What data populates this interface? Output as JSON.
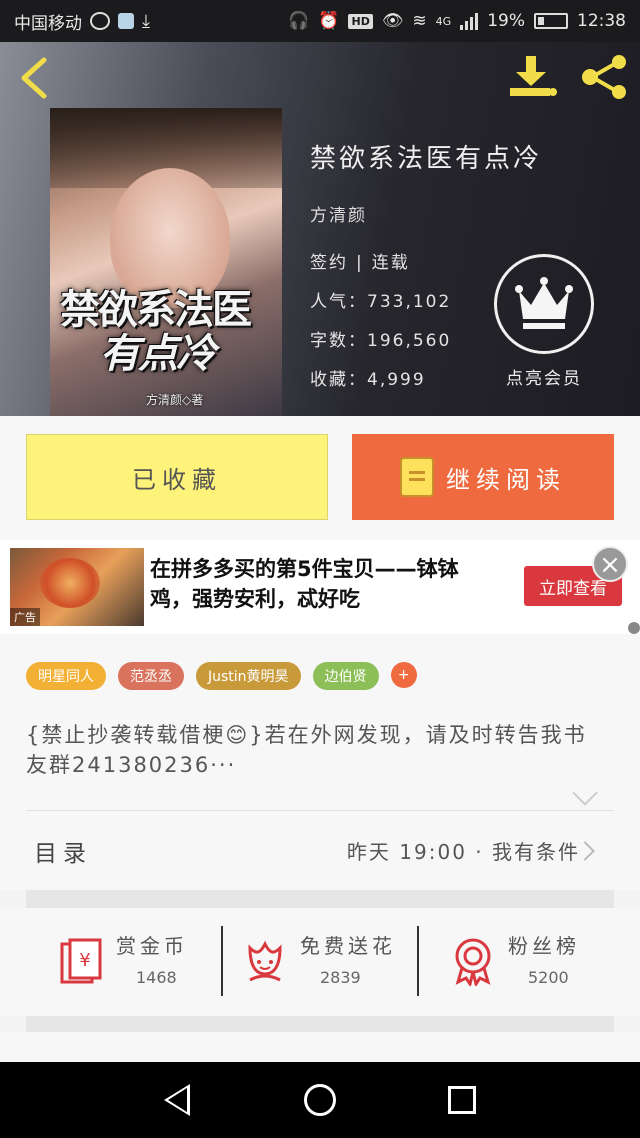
{
  "status_bar": {
    "carrier": "中国移动",
    "network": "4G",
    "battery": "19%",
    "time": "12:38",
    "hd": "HD"
  },
  "header": {
    "back_icon": "chevron-left-icon",
    "download_icon": "download-icon",
    "share_icon": "share-icon"
  },
  "book": {
    "cover_title_line1": "禁欲系法医",
    "cover_title_line2": "有点冷",
    "cover_author": "方清颜◇著",
    "title": "禁欲系法医有点冷",
    "author": "方清颜",
    "status_signed": "签约",
    "status_serial": "连载",
    "popularity_label": "人气：",
    "popularity": "733,102",
    "word_count_label": "字数：",
    "word_count": "196,560",
    "favorites_label": "收藏：",
    "favorites": "4,999"
  },
  "vip": {
    "label": "点亮会员",
    "icon": "crown-icon"
  },
  "actions": {
    "collected_label": "已收藏",
    "continue_label": "继续阅读",
    "continue_icon": "book-icon"
  },
  "ad": {
    "tag": "广告",
    "text": "在拼多多买的第5件宝贝——钵钵鸡，强势安利，忒好吃",
    "cta": "立即查看"
  },
  "tags": [
    {
      "label": "明星同人",
      "color": "#f2b135"
    },
    {
      "label": "范丞丞",
      "color": "#d9735e"
    },
    {
      "label": "Justin黄明昊",
      "color": "#c99a3a"
    },
    {
      "label": "边伯贤",
      "color": "#8dbf59"
    }
  ],
  "tags_more": "+",
  "description": "{禁止抄袭转载借梗😊}若在外网发现，请及时转告我书友群241380236···",
  "toc": {
    "label": "目录",
    "latest": "昨天 19:00 · 我有条件"
  },
  "stats": [
    {
      "name": "赏金币",
      "value": "1468",
      "icon": "red-envelope-icon"
    },
    {
      "name": "免费送花",
      "value": "2839",
      "icon": "flower-icon"
    },
    {
      "name": "粉丝榜",
      "value": "5200",
      "icon": "medal-icon"
    }
  ],
  "nav": {
    "back": "nav-back-icon",
    "home": "nav-home-icon",
    "recent": "nav-recent-icon"
  },
  "colors": {
    "accent_yellow": "#fdf27a",
    "accent_orange": "#ef6b3f",
    "icon_red": "#d9393e",
    "header_icon_yellow": "#f1dd4a"
  }
}
